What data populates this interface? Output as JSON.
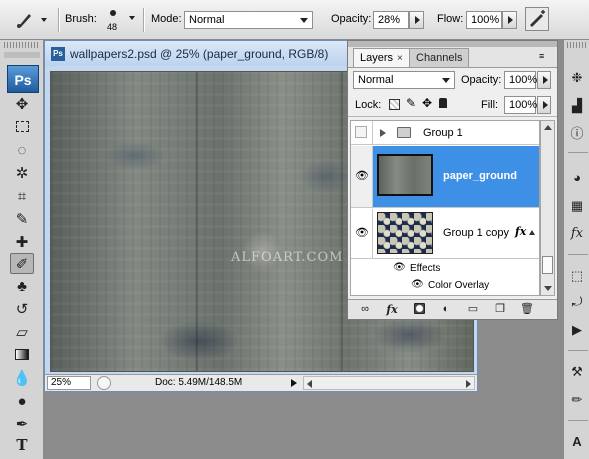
{
  "options_bar": {
    "brush_label": "Brush:",
    "brush_size": "48",
    "mode_label": "Mode:",
    "mode_value": "Normal",
    "opacity_label": "Opacity:",
    "opacity_value": "28%",
    "flow_label": "Flow:",
    "flow_value": "100%"
  },
  "toolbox": {
    "logo": "Ps",
    "type_tool": "T"
  },
  "document": {
    "tab_icon": "Ps",
    "title": "wallpapers2.psd @ 25% (paper_ground, RGB/8)",
    "watermark": "ALFOART.COM",
    "zoom": "25%",
    "doc_info": "Doc: 5.49M/148.5M"
  },
  "layers_panel": {
    "tabs": [
      {
        "label": "Layers",
        "active": true
      },
      {
        "label": "Channels",
        "active": false
      }
    ],
    "tab_close": "×",
    "blend_mode": "Normal",
    "opacity_label": "Opacity:",
    "opacity_value": "100%",
    "lock_label": "Lock:",
    "fill_label": "Fill:",
    "fill_value": "100%",
    "layers": [
      {
        "name": "Group 1",
        "type": "group",
        "visible": false,
        "selected": false
      },
      {
        "name": "paper_ground",
        "type": "layer",
        "visible": true,
        "selected": true
      },
      {
        "name": "Group 1 copy",
        "type": "layer",
        "visible": true,
        "selected": false,
        "fx": "fx"
      }
    ],
    "effects_label": "Effects",
    "effect_items": [
      "Color Overlay"
    ],
    "selection_color": "#3e8fe6"
  },
  "right_dock": {
    "char_icon": "A"
  }
}
